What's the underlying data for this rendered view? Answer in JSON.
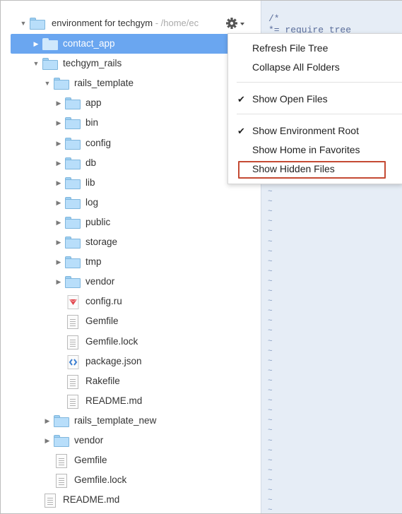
{
  "tree": {
    "root": {
      "name": "environment for techgym",
      "path": " - /home/ec"
    },
    "items": [
      {
        "label": "contact_app",
        "kind": "folder",
        "depth": 1,
        "expanded": false,
        "selected": true
      },
      {
        "label": "techgym_rails",
        "kind": "folder",
        "depth": 1,
        "expanded": true,
        "selected": false
      },
      {
        "label": "rails_template",
        "kind": "folder",
        "depth": 2,
        "expanded": true,
        "selected": false
      },
      {
        "label": "app",
        "kind": "folder",
        "depth": 3,
        "expanded": false,
        "selected": false
      },
      {
        "label": "bin",
        "kind": "folder",
        "depth": 3,
        "expanded": false,
        "selected": false
      },
      {
        "label": "config",
        "kind": "folder",
        "depth": 3,
        "expanded": false,
        "selected": false
      },
      {
        "label": "db",
        "kind": "folder",
        "depth": 3,
        "expanded": false,
        "selected": false
      },
      {
        "label": "lib",
        "kind": "folder",
        "depth": 3,
        "expanded": false,
        "selected": false
      },
      {
        "label": "log",
        "kind": "folder",
        "depth": 3,
        "expanded": false,
        "selected": false
      },
      {
        "label": "public",
        "kind": "folder",
        "depth": 3,
        "expanded": false,
        "selected": false
      },
      {
        "label": "storage",
        "kind": "folder",
        "depth": 3,
        "expanded": false,
        "selected": false
      },
      {
        "label": "tmp",
        "kind": "folder",
        "depth": 3,
        "expanded": false,
        "selected": false
      },
      {
        "label": "vendor",
        "kind": "folder",
        "depth": 3,
        "expanded": false,
        "selected": false
      },
      {
        "label": "config.ru",
        "kind": "ruby-file",
        "depth": 3,
        "selected": false
      },
      {
        "label": "Gemfile",
        "kind": "text-file",
        "depth": 3,
        "selected": false
      },
      {
        "label": "Gemfile.lock",
        "kind": "text-file",
        "depth": 3,
        "selected": false
      },
      {
        "label": "package.json",
        "kind": "json-file",
        "depth": 3,
        "selected": false
      },
      {
        "label": "Rakefile",
        "kind": "text-file",
        "depth": 3,
        "selected": false
      },
      {
        "label": "README.md",
        "kind": "text-file",
        "depth": 3,
        "selected": false
      },
      {
        "label": "rails_template_new",
        "kind": "folder",
        "depth": 2,
        "expanded": false,
        "selected": false
      },
      {
        "label": "vendor",
        "kind": "folder",
        "depth": 2,
        "expanded": false,
        "selected": false
      },
      {
        "label": "Gemfile",
        "kind": "text-file",
        "depth": 2,
        "selected": false
      },
      {
        "label": "Gemfile.lock",
        "kind": "text-file",
        "depth": 2,
        "selected": false
      },
      {
        "label": "README.md",
        "kind": "text-file",
        "depth": 1,
        "selected": false
      }
    ]
  },
  "settings_icon": "gear-icon",
  "menu": {
    "items": [
      {
        "label": "Refresh File Tree",
        "checked": false
      },
      {
        "label": "Collapse All Folders",
        "checked": false
      },
      {
        "label": "Show Open Files",
        "checked": true
      },
      {
        "label": "Show Environment Root",
        "checked": true
      },
      {
        "label": "Show Home in Favorites",
        "checked": false
      },
      {
        "label": "Show Hidden Files",
        "checked": false,
        "highlighted": true
      }
    ]
  },
  "editor": {
    "lines": [
      "/*",
      " *= require_tree"
    ],
    "filler": "~"
  },
  "colors": {
    "selection": "#6aa6f0",
    "folder": "#b8defa",
    "editor_bg": "#e6edf6",
    "highlight_border": "#c44a33"
  }
}
